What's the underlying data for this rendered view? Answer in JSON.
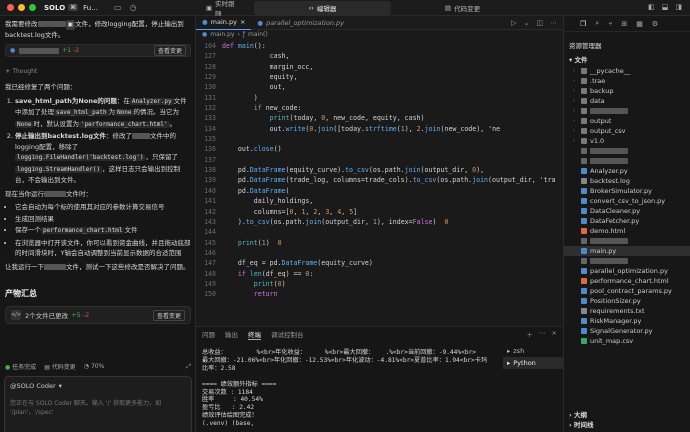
{
  "topbar": {
    "app": "SOLO",
    "app_badge": "⌘",
    "project": "Fu...",
    "tab_live": "实时跟随",
    "tab_editor": "编辑器",
    "tab_changes": "代码变更"
  },
  "chat": {
    "user_msg_a": "我需要修改",
    "user_msg_b": "文件，修改logging配置，停止输出到backtest.log文件。",
    "file_chip_plus": "+1",
    "file_chip_minus": "-2",
    "review": "查看变更",
    "thought": "Thought",
    "intro": "我已经修复了两个问题：",
    "item1_title": "save_html_path为None的问题",
    "item1_text_a": "：在",
    "item1_code1": "Analyzer.py",
    "item1_text_b": "文件中添加了处理",
    "item1_code2": "save_html_path",
    "item1_text_c": "为",
    "item1_code3": "None",
    "item1_text_d": "的情况。当它为",
    "item1_code4": "None",
    "item1_text_e": "时，默认设置为",
    "item1_code5": "'performance_chart.html'",
    "item1_text_f": "。",
    "item2_title": "停止输出到backtest.log文件",
    "item2_text_a": "：修改了",
    "item2_text_b": "文件中的logging配置，移除了",
    "item2_code1": "logging.FileHandler('backtest.log')",
    "item2_text_c": "，只保留了",
    "item2_code2": "logging.StreamHandler()",
    "item2_text_d": "，这样日志只会输出到控制台，不会输出到文件。",
    "now_run_a": "现在当你运行",
    "now_run_b": "文件时：",
    "b1": "它会自动为每个标的使用其对应的参数计算交易信号",
    "b2": "生成回测结果",
    "b3": "保存一个",
    "b3_code": "performance_chart.html",
    "b3_tail": "文件",
    "b4": "在浏览器中打开该文件，你可以看到资金曲线，并且拖动底部的时间滑块时，Y轴会自动调整到当前显示数据的合适范围",
    "test_a": "让我运行一下",
    "test_b": "文件，测试一下这些修改是否解决了问题。",
    "summary_title": "产物汇总",
    "summary_files": "2个文件已更改",
    "summary_plus": "+5",
    "summary_minus": "-2",
    "summary_review": "查看变更",
    "status_done": "任务完成",
    "status_changes": "代码变更",
    "status_pct": "70%",
    "input_head": "@SOLO Coder",
    "input_ph": "您正在与 SOLO Coder 聊天。输入 '/' 获取更多能力，如 '/plan'，'/spec'"
  },
  "editor": {
    "tab1": "main.py",
    "tab2": "parallel_optimization.py",
    "bread_file": "main.py",
    "bread_sym": "main()",
    "code": [
      {
        "n": "104",
        "t": "def main():"
      },
      {
        "n": "127",
        "t": "            cash,"
      },
      {
        "n": "128",
        "t": "            margin_occ,"
      },
      {
        "n": "129",
        "t": "            equity,"
      },
      {
        "n": "130",
        "t": "            out,"
      },
      {
        "n": "131",
        "t": "        )"
      },
      {
        "n": "132",
        "t": "        if new_code:"
      },
      {
        "n": "133",
        "t": "            print(today, 'new', new_code, equity, cash)"
      },
      {
        "n": "134",
        "t": "            out.write('\\t'.join([today.strftime('%Y-%m-%d'), ','.join(new_code), 'ne"
      },
      {
        "n": "135",
        "t": ""
      },
      {
        "n": "136",
        "t": "    out.close()"
      },
      {
        "n": "137",
        "t": ""
      },
      {
        "n": "138",
        "t": "    pd.DataFrame(equity_curve).to_csv(os.path.join(output_dir, 'equity_curve.csv'),"
      },
      {
        "n": "139",
        "t": "    pd.DataFrame(trade_log, columns=trade_cols).to_csv(os.path.join(output_dir, 'tra"
      },
      {
        "n": "140",
        "t": "    pd.DataFrame("
      },
      {
        "n": "141",
        "t": "        daily_holdings,"
      },
      {
        "n": "142",
        "t": "        columns=['date', 'code', 'lots', 'direction', 'avg_price', 'sector']"
      },
      {
        "n": "143",
        "t": "    ).to_csv(os.path.join(output_dir, 'daily_holdings.csv'), index=False)  # 新增/修改"
      },
      {
        "n": "144",
        "t": ""
      },
      {
        "n": "145",
        "t": "    print(f'Done! Files saved in: {output_dir}')  # 新增/修改"
      },
      {
        "n": "146",
        "t": ""
      },
      {
        "n": "147",
        "t": "    df_eq = pd.DataFrame(equity_curve)"
      },
      {
        "n": "148",
        "t": "    if len(df_eq) == 0:"
      },
      {
        "n": "149",
        "t": "        print('无回测交易日，跳过绩效分析。')"
      },
      {
        "n": "150",
        "t": "        return"
      }
    ]
  },
  "terminal": {
    "tabs": [
      "问题",
      "输出",
      "终端",
      "调试控制台"
    ],
    "active": "终端",
    "output": "总收益：        %<br>年化收益：     %<br>最大回撤：   .%<br>当前回撤：-9.44%<br>\n最大回撤：-21.06%<br>年化回撤：-12.53%<br>年化波动：-4.81%<br>夏普比率：1.94<br>卡玛\n比率：2.58\n\n==== 绩效额外指标 ====\n交易次数 : 1184\n胜率     : 40.54%\n盈亏比   : 2.42\n绩效评估绘图完成！\n(.venv) (base,",
    "shells": [
      "zsh",
      "Python"
    ]
  },
  "explorer": {
    "title": "资源管理器",
    "section": "文件",
    "items": [
      {
        "name": "__pycache__",
        "type": "folder",
        "depth": 1
      },
      {
        "name": ".trae",
        "type": "folder",
        "depth": 1
      },
      {
        "name": "backup",
        "type": "folder",
        "depth": 1
      },
      {
        "name": "data",
        "type": "folder",
        "depth": 1
      },
      {
        "name": "",
        "type": "folder",
        "depth": 1,
        "blur": true
      },
      {
        "name": "output",
        "type": "folder",
        "depth": 1
      },
      {
        "name": "output_csv",
        "type": "folder",
        "depth": 1
      },
      {
        "name": "v1.0",
        "type": "folder",
        "depth": 1
      },
      {
        "name": "",
        "type": "file",
        "depth": 1,
        "blur": true
      },
      {
        "name": "",
        "type": "file",
        "depth": 1,
        "blur": true
      },
      {
        "name": "Analyzer.py",
        "type": "py",
        "depth": 1
      },
      {
        "name": "backtest.log",
        "type": "log",
        "depth": 1
      },
      {
        "name": "BrokerSimulator.py",
        "type": "py",
        "depth": 1
      },
      {
        "name": "convert_csv_to_json.py",
        "type": "py",
        "depth": 1
      },
      {
        "name": "DataCleaner.py",
        "type": "py",
        "depth": 1
      },
      {
        "name": "DataFetcher.py",
        "type": "py",
        "depth": 1
      },
      {
        "name": "demo.html",
        "type": "html",
        "depth": 1
      },
      {
        "name": "",
        "type": "file",
        "depth": 1,
        "blur": true
      },
      {
        "name": "main.py",
        "type": "py",
        "depth": 1,
        "sel": true
      },
      {
        "name": "",
        "type": "file",
        "depth": 1,
        "blur": true
      },
      {
        "name": "parallel_optimization.py",
        "type": "py",
        "depth": 1
      },
      {
        "name": "performance_chart.html",
        "type": "html",
        "depth": 1
      },
      {
        "name": "pool_contract_params.py",
        "type": "py",
        "depth": 1
      },
      {
        "name": "PositionSizer.py",
        "type": "py",
        "depth": 1
      },
      {
        "name": "requirements.txt",
        "type": "txt",
        "depth": 1
      },
      {
        "name": "RiskManager.py",
        "type": "py",
        "depth": 1
      },
      {
        "name": "SignalGenerator.py",
        "type": "py",
        "depth": 1
      },
      {
        "name": "unit_map.csv",
        "type": "csv",
        "depth": 1
      }
    ],
    "outline": "大纲",
    "timeline": "时间线"
  },
  "colors": {
    "py": "#4f8cc9",
    "folder": "#7a7a7a",
    "html": "#e06c3c",
    "log": "#888888",
    "txt": "#888888",
    "csv": "#3fa36a",
    "file": "#666666"
  }
}
